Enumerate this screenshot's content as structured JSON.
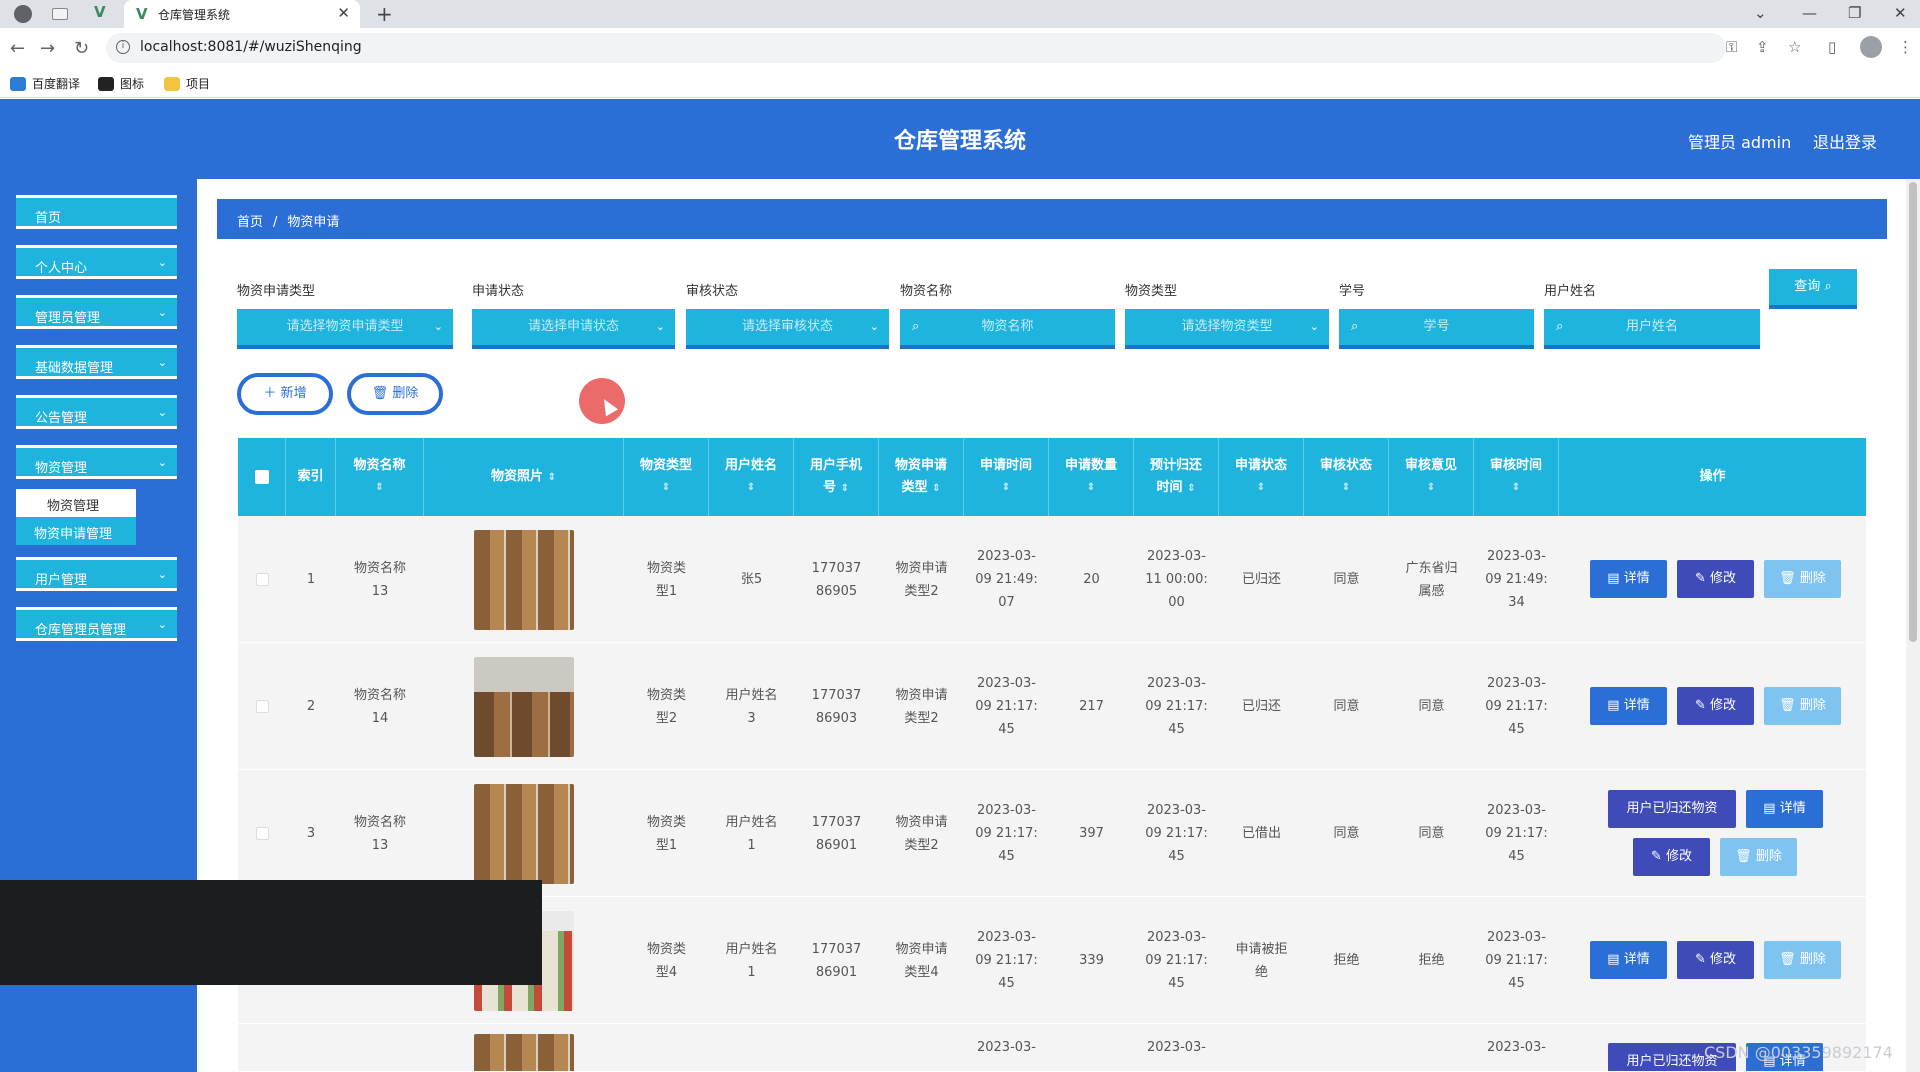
{
  "browser": {
    "tab_title": "仓库管理系统",
    "url": "localhost:8081/#/wuziShenqing",
    "bookmarks": [
      "百度翻译",
      "图标",
      "项目"
    ]
  },
  "header": {
    "title": "仓库管理系统",
    "user": "管理员 admin",
    "logout": "退出登录"
  },
  "sidebar": {
    "items": [
      {
        "label": "首页"
      },
      {
        "label": "个人中心"
      },
      {
        "label": "管理员管理"
      },
      {
        "label": "基础数据管理"
      },
      {
        "label": "公告管理"
      },
      {
        "label": "物资管理"
      },
      {
        "label": "用户管理"
      },
      {
        "label": "仓库管理员管理"
      }
    ],
    "submenu": [
      "物资管理",
      "物资申请管理"
    ]
  },
  "breadcrumb": {
    "home": "首页",
    "sep": "/",
    "current": "物资申请"
  },
  "filters": [
    {
      "label": "物资申请类型",
      "placeholder": "请选择物资申请类型"
    },
    {
      "label": "申请状态",
      "placeholder": "请选择申请状态"
    },
    {
      "label": "审核状态",
      "placeholder": "请选择审核状态"
    },
    {
      "label": "物资名称",
      "placeholder": "物资名称"
    },
    {
      "label": "物资类型",
      "placeholder": "请选择物资类型"
    },
    {
      "label": "学号",
      "placeholder": "学号"
    },
    {
      "label": "用户姓名",
      "placeholder": "用户姓名"
    }
  ],
  "query_button": "查询",
  "actions": {
    "add": "新增",
    "delete": "删除"
  },
  "table": {
    "headers": [
      "索引",
      "物资名称",
      "物资照片",
      "物资类型",
      "用户姓名",
      "用户手机号",
      "物资申请类型",
      "申请时间",
      "申请数量",
      "预计归还时间",
      "申请状态",
      "审核状态",
      "审核意见",
      "审核时间",
      "操作"
    ],
    "rows": [
      {
        "index": "1",
        "name": "物资名称13",
        "type": "物资类型1",
        "user": "张5",
        "phone": "17703786905",
        "apply_type": "物资申请类型2",
        "apply_time": "2023-03-09 21:49:07",
        "qty": "20",
        "return_time": "2023-03-11 00:00:00",
        "apply_status": "已归还",
        "audit_status": "同意",
        "audit_opinion": "广东省归属感",
        "audit_time": "2023-03-09 21:49:34"
      },
      {
        "index": "2",
        "name": "物资名称14",
        "type": "物资类型2",
        "user": "用户姓名3",
        "phone": "17703786903",
        "apply_type": "物资申请类型2",
        "apply_time": "2023-03-09 21:17:45",
        "qty": "217",
        "return_time": "2023-03-09 21:17:45",
        "apply_status": "已归还",
        "audit_status": "同意",
        "audit_opinion": "同意",
        "audit_time": "2023-03-09 21:17:45"
      },
      {
        "index": "3",
        "name": "物资名称13",
        "type": "物资类型1",
        "user": "用户姓名1",
        "phone": "17703786901",
        "apply_type": "物资申请类型2",
        "apply_time": "2023-03-09 21:17:45",
        "qty": "397",
        "return_time": "2023-03-09 21:17:45",
        "apply_status": "已借出",
        "audit_status": "同意",
        "audit_opinion": "同意",
        "audit_time": "2023-03-09 21:17:45"
      },
      {
        "index": "",
        "name": "",
        "type": "物资类型4",
        "user": "用户姓名1",
        "phone": "17703786901",
        "apply_type": "物资申请类型4",
        "apply_time": "2023-03-09 21:17:45",
        "qty": "339",
        "return_time": "2023-03-09 21:17:45",
        "apply_status": "申请被拒绝",
        "audit_status": "拒绝",
        "audit_opinion": "拒绝",
        "audit_time": "2023-03-09 21:17:45"
      }
    ],
    "partial_row": {
      "apply_time": "2023-03-",
      "return_time": "2023-03-",
      "audit_time": "2023-03-"
    },
    "ops": {
      "detail": "详情",
      "edit": "修改",
      "delete": "删除",
      "returned": "用户已归还物资"
    }
  },
  "watermark": "CSDN @003359892174"
}
